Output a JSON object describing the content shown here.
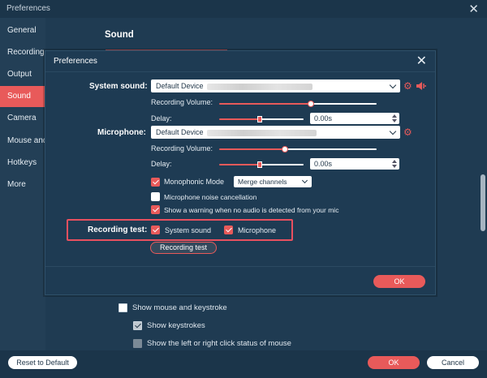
{
  "window": {
    "title": "Preferences"
  },
  "sidebar": {
    "items": [
      {
        "label": "General"
      },
      {
        "label": "Recording Preferences"
      },
      {
        "label": "Output"
      },
      {
        "label": "Sound"
      },
      {
        "label": "Camera"
      },
      {
        "label": "Mouse and Keystroke"
      },
      {
        "label": "Hotkeys"
      },
      {
        "label": "More"
      }
    ],
    "active_index": 3
  },
  "content": {
    "section_title": "Sound",
    "show_mouse": "Show mouse and keystroke",
    "show_keystrokes": "Show keystrokes",
    "show_click": "Show the left or right click status of mouse"
  },
  "footer": {
    "reset": "Reset to Default",
    "ok": "OK",
    "cancel": "Cancel"
  },
  "modal": {
    "title": "Preferences",
    "system_sound": {
      "label": "System sound:",
      "device": "Default Device",
      "volume_label": "Recording Volume:",
      "volume": 0.58,
      "delay_label": "Delay:",
      "delay": 0.48,
      "delay_value": "0.00s"
    },
    "microphone": {
      "label": "Microphone:",
      "device": "Default Device",
      "volume_label": "Recording Volume:",
      "volume": 0.42,
      "delay_label": "Delay:",
      "delay": 0.48,
      "delay_value": "0.00s"
    },
    "mono": {
      "label": "Monophonic Mode",
      "checked": true,
      "option": "Merge channels"
    },
    "noise": {
      "label": "Microphone noise cancellation",
      "checked": false
    },
    "warning": {
      "label": "Show a warning when no audio is detected from your mic",
      "checked": true
    },
    "recording_test": {
      "label": "Recording test:",
      "system_sound": "System sound",
      "microphone": "Microphone",
      "button": "Recording test"
    },
    "ok": "OK"
  },
  "colors": {
    "accent": "#e85a5a",
    "background": "#1f3b52",
    "highlight_border": "#e8505f"
  }
}
